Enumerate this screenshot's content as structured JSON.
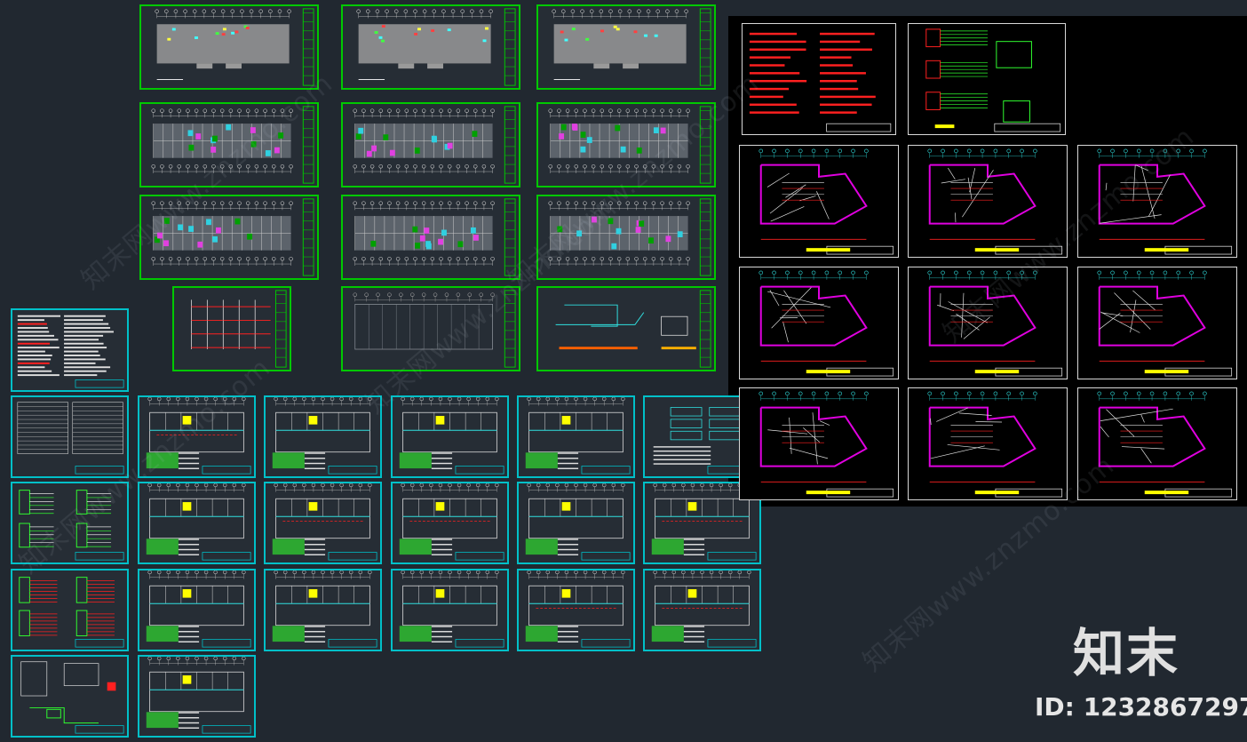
{
  "canvas": {
    "background_color": "#212830",
    "model_space_color": "#000000"
  },
  "colors": {
    "frame_green": "#00c800",
    "frame_cyan": "#00c0c8",
    "frame_white": "#d8d8d8",
    "cad_magenta": "#e000e0",
    "cad_red": "#ff2020",
    "cad_yellow": "#ffff00",
    "plan_gray": "#9a9a9a"
  },
  "groups": {
    "green_frames": {
      "frame_color": "green",
      "content": "floor-plan layouts"
    },
    "cyan_frames": {
      "frame_color": "cyan",
      "content": "electrical plans and schedules"
    },
    "black_frames": {
      "frame_color": "white",
      "content": "floor plans with magenta walls"
    }
  },
  "watermarks": {
    "text": "知末网www.znzmo.com"
  },
  "brand": {
    "logo_text": "知末",
    "image_id": "ID: 1232867297"
  }
}
